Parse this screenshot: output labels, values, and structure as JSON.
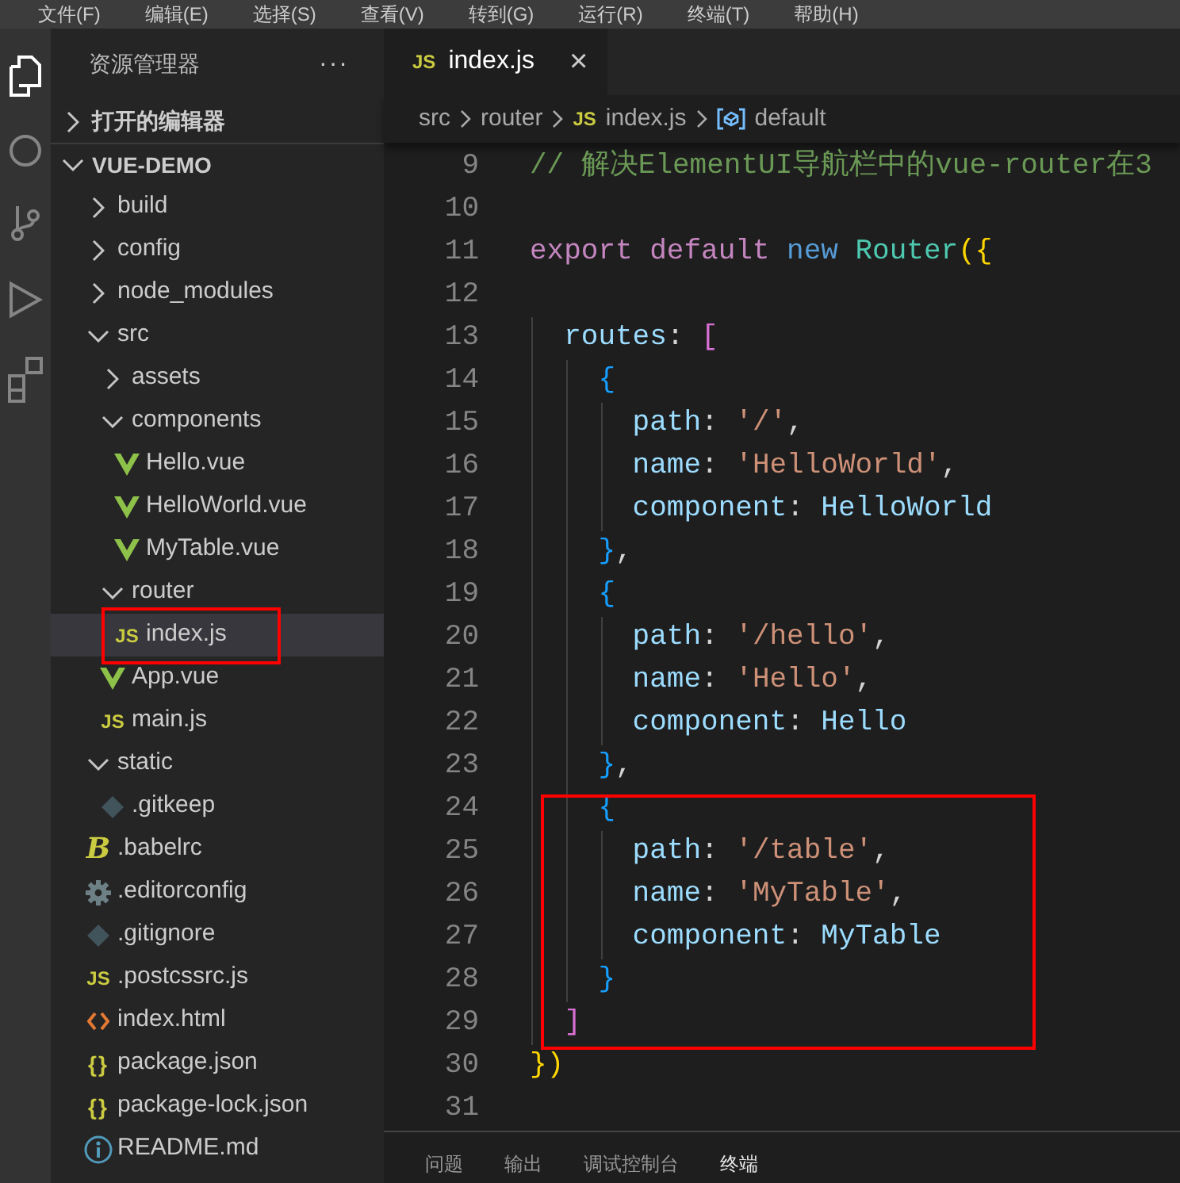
{
  "menu": [
    "文件(F)",
    "编辑(E)",
    "选择(S)",
    "查看(V)",
    "转到(G)",
    "运行(R)",
    "终端(T)",
    "帮助(H)"
  ],
  "explorer": {
    "title": "资源管理器",
    "more": "···",
    "sections": [
      {
        "label": "打开的编辑器",
        "expanded": false
      },
      {
        "label": "VUE-DEMO",
        "expanded": true,
        "children": [
          {
            "name": "build",
            "kind": "folder",
            "expanded": false
          },
          {
            "name": "config",
            "kind": "folder",
            "expanded": false
          },
          {
            "name": "node_modules",
            "kind": "folder",
            "expanded": false
          },
          {
            "name": "src",
            "kind": "folder",
            "expanded": true,
            "children": [
              {
                "name": "assets",
                "kind": "folder",
                "expanded": false
              },
              {
                "name": "components",
                "kind": "folder",
                "expanded": true,
                "children": [
                  {
                    "name": "Hello.vue",
                    "kind": "vue"
                  },
                  {
                    "name": "HelloWorld.vue",
                    "kind": "vue"
                  },
                  {
                    "name": "MyTable.vue",
                    "kind": "vue"
                  }
                ]
              },
              {
                "name": "router",
                "kind": "folder",
                "expanded": true,
                "children": [
                  {
                    "name": "index.js",
                    "kind": "js",
                    "badge": "JS",
                    "selected": true,
                    "marked": true
                  }
                ]
              },
              {
                "name": "App.vue",
                "kind": "vue"
              },
              {
                "name": "main.js",
                "kind": "js",
                "badge": "JS"
              }
            ]
          },
          {
            "name": "static",
            "kind": "folder",
            "expanded": true,
            "children": [
              {
                "name": ".gitkeep",
                "kind": "git"
              }
            ]
          },
          {
            "name": ".babelrc",
            "kind": "babel",
            "badge": "B"
          },
          {
            "name": ".editorconfig",
            "kind": "config"
          },
          {
            "name": ".gitignore",
            "kind": "git"
          },
          {
            "name": ".postcssrc.js",
            "kind": "js",
            "badge": "JS"
          },
          {
            "name": "index.html",
            "kind": "html"
          },
          {
            "name": "package.json",
            "kind": "json",
            "badge": "{}"
          },
          {
            "name": "package-lock.json",
            "kind": "json",
            "badge": "{}"
          },
          {
            "name": "README.md",
            "kind": "readme"
          }
        ]
      }
    ]
  },
  "tabs": [
    {
      "label": "index.js",
      "badge": "JS",
      "close": "×",
      "selected": true
    }
  ],
  "breadcrumb": [
    {
      "label": "src",
      "kind": "folder"
    },
    {
      "label": "router",
      "kind": "folder"
    },
    {
      "label": "index.js",
      "kind": "file",
      "badge": "JS"
    },
    {
      "label": "default",
      "kind": "symbol"
    }
  ],
  "code": {
    "lines": [
      {
        "number": "9",
        "tokens": [
          {
            "kind": "comment",
            "text": "// 解决ElementUI导航栏中的vue-router在3"
          }
        ]
      },
      {
        "number": "10"
      },
      {
        "number": "11",
        "tokens": [
          {
            "kind": "keyword",
            "text": "export default "
          },
          {
            "kind": "storage",
            "text": "new "
          },
          {
            "kind": "class",
            "text": "Router"
          },
          {
            "kind": "bracket1",
            "text": "({"
          }
        ]
      },
      {
        "number": "12"
      },
      {
        "number": "13",
        "tokens": [
          {
            "kind": "property",
            "text": "  routes"
          },
          {
            "kind": "plain",
            "text": ": "
          },
          {
            "kind": "bracket2",
            "text": "["
          }
        ]
      },
      {
        "number": "14",
        "tokens": [
          {
            "kind": "bracket3",
            "text": "    {"
          }
        ]
      },
      {
        "number": "15",
        "tokens": [
          {
            "kind": "property",
            "text": "      path"
          },
          {
            "kind": "plain",
            "text": ": "
          },
          {
            "kind": "string",
            "text": "'/'"
          },
          {
            "kind": "plain",
            "text": ","
          }
        ]
      },
      {
        "number": "16",
        "tokens": [
          {
            "kind": "property",
            "text": "      name"
          },
          {
            "kind": "plain",
            "text": ": "
          },
          {
            "kind": "string",
            "text": "'HelloWorld'"
          },
          {
            "kind": "plain",
            "text": ","
          }
        ]
      },
      {
        "number": "17",
        "tokens": [
          {
            "kind": "property",
            "text": "      component"
          },
          {
            "kind": "plain",
            "text": ": "
          },
          {
            "kind": "variable",
            "text": "HelloWorld"
          }
        ]
      },
      {
        "number": "18",
        "tokens": [
          {
            "kind": "bracket3",
            "text": "    }"
          },
          {
            "kind": "plain",
            "text": ","
          }
        ]
      },
      {
        "number": "19",
        "tokens": [
          {
            "kind": "bracket3",
            "text": "    {"
          }
        ]
      },
      {
        "number": "20",
        "tokens": [
          {
            "kind": "property",
            "text": "      path"
          },
          {
            "kind": "plain",
            "text": ": "
          },
          {
            "kind": "string",
            "text": "'/hello'"
          },
          {
            "kind": "plain",
            "text": ","
          }
        ]
      },
      {
        "number": "21",
        "tokens": [
          {
            "kind": "property",
            "text": "      name"
          },
          {
            "kind": "plain",
            "text": ": "
          },
          {
            "kind": "string",
            "text": "'Hello'"
          },
          {
            "kind": "plain",
            "text": ","
          }
        ]
      },
      {
        "number": "22",
        "tokens": [
          {
            "kind": "property",
            "text": "      component"
          },
          {
            "kind": "plain",
            "text": ": "
          },
          {
            "kind": "variable",
            "text": "Hello"
          }
        ]
      },
      {
        "number": "23",
        "tokens": [
          {
            "kind": "bracket3",
            "text": "    }"
          },
          {
            "kind": "plain",
            "text": ","
          }
        ]
      },
      {
        "number": "24",
        "marked": true,
        "tokens": [
          {
            "kind": "bracket3",
            "text": "    {"
          }
        ]
      },
      {
        "number": "25",
        "marked": true,
        "tokens": [
          {
            "kind": "property",
            "text": "      path"
          },
          {
            "kind": "plain",
            "text": ": "
          },
          {
            "kind": "string",
            "text": "'/table'"
          },
          {
            "kind": "plain",
            "text": ","
          }
        ]
      },
      {
        "number": "26",
        "marked": true,
        "tokens": [
          {
            "kind": "property",
            "text": "      name"
          },
          {
            "kind": "plain",
            "text": ": "
          },
          {
            "kind": "string",
            "text": "'MyTable'"
          },
          {
            "kind": "plain",
            "text": ","
          }
        ]
      },
      {
        "number": "27",
        "marked": true,
        "tokens": [
          {
            "kind": "property",
            "text": "      component"
          },
          {
            "kind": "plain",
            "text": ": "
          },
          {
            "kind": "variable",
            "text": "MyTable"
          }
        ]
      },
      {
        "number": "28",
        "marked": true,
        "tokens": [
          {
            "kind": "bracket3",
            "text": "    }"
          }
        ]
      },
      {
        "number": "29",
        "marked": true,
        "tokens": [
          {
            "kind": "bracket2",
            "text": "  ]"
          }
        ]
      },
      {
        "number": "30",
        "tokens": [
          {
            "kind": "bracket1",
            "text": "})"
          }
        ]
      },
      {
        "number": "31"
      }
    ]
  },
  "panel_tabs": [
    {
      "label": "问题",
      "selected": false
    },
    {
      "label": "输出",
      "selected": false
    },
    {
      "label": "调试控制台",
      "selected": false
    },
    {
      "label": "终端",
      "selected": true
    }
  ]
}
